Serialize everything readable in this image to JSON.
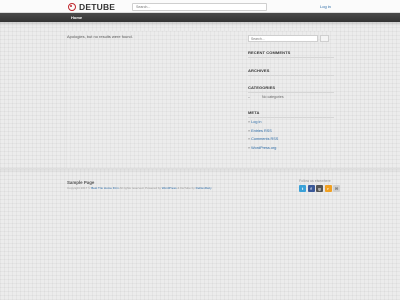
{
  "header": {
    "logo_text": "DETUBE",
    "search_placeholder": "Search...",
    "login_label": "Log in"
  },
  "nav": {
    "home_label": "Home"
  },
  "main": {
    "no_results_text": "Apologies, but no results were found."
  },
  "sidebar": {
    "search_placeholder": "Search...",
    "recent_comments_title": "RECENT COMMENTS",
    "archives_title": "ARCHIVES",
    "categories_title": "CATEGORIES",
    "no_categories_text": "No categories",
    "meta_title": "META",
    "meta_links": [
      "Log in",
      "Entries RSS",
      "Comments RSS",
      "WordPress.org"
    ]
  },
  "footer": {
    "page_link": "Sample Page",
    "copyright_prefix": "Copyright 2017 © ",
    "copyright_site": "Best Trio Home Firm",
    "copyright_middle": " All rights reserved. Powered by ",
    "copyright_wp": "WordPress",
    "copyright_by": " & DeTube by ",
    "copyright_theme": "DeDevRazy",
    "follow_label": "Follow us elsewhere",
    "social_icons": [
      "twitter-icon",
      "facebook-icon",
      "googleplus-icon",
      "rss-icon",
      "email-icon"
    ]
  },
  "colors": {
    "brand_red": "#c0272d",
    "link_blue": "#2a6aa6",
    "nav_bg": "#3a3a3a"
  }
}
